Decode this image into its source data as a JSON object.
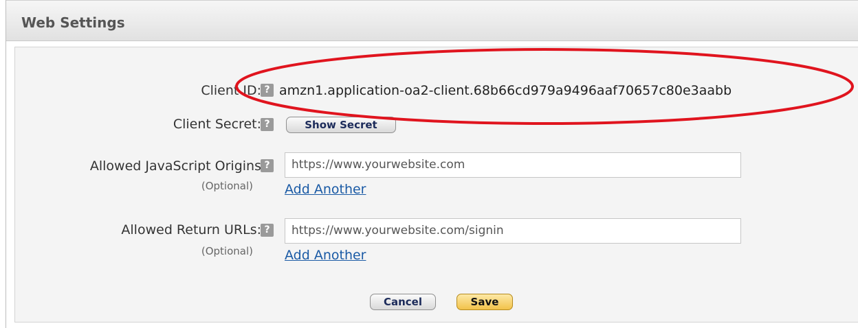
{
  "panel": {
    "title": "Web Settings"
  },
  "form": {
    "client_id": {
      "label": "Client ID:",
      "value": "amzn1.application-oa2-client.68b66cd979a9496aaf70657c80e3aabb"
    },
    "client_secret": {
      "label": "Client Secret:",
      "button_label": "Show Secret"
    },
    "js_origins": {
      "label": "Allowed JavaScript Origins",
      "optional": "(Optional)",
      "placeholder": "https://www.yourwebsite.com",
      "add_link": "Add Another"
    },
    "return_urls": {
      "label": "Allowed Return URLs:",
      "optional": "(Optional)",
      "placeholder": "https://www.yourwebsite.com/signin",
      "add_link": "Add Another"
    },
    "help_glyph": "?"
  },
  "actions": {
    "cancel_label": "Cancel",
    "save_label": "Save"
  },
  "annotation": {
    "color": "#e0141e",
    "shape": "ellipse"
  }
}
